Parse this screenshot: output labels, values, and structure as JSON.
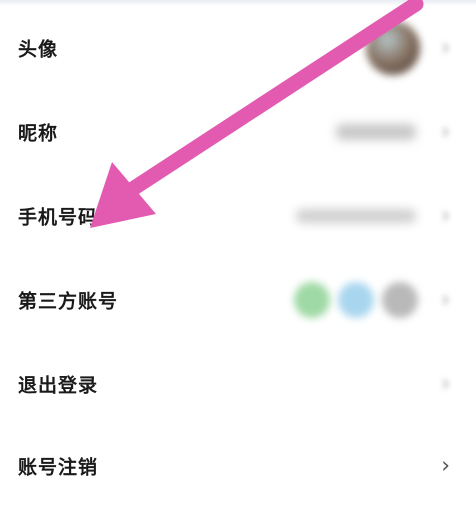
{
  "settings": {
    "rows": [
      {
        "label": "头像"
      },
      {
        "label": "昵称"
      },
      {
        "label": "手机号码"
      },
      {
        "label": "第三方账号"
      },
      {
        "label": "退出登录"
      },
      {
        "label": "账号注销"
      }
    ],
    "chevron": "›"
  },
  "icons": {
    "third_party": [
      "wechat-icon",
      "qq-icon",
      "weibo-icon"
    ]
  },
  "colors": {
    "annotation_arrow": "#e25bb1",
    "label_text": "#1a1a1a",
    "third_party_icons": [
      "#9fd9a5",
      "#a9d6ef",
      "#b9b9b9"
    ]
  }
}
